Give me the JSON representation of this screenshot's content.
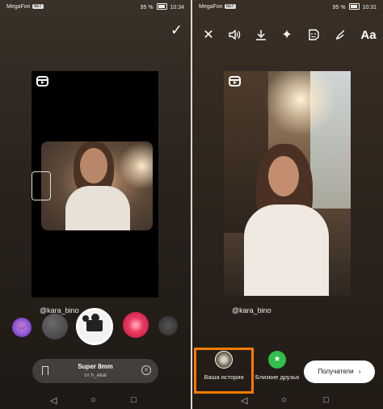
{
  "status_bar": {
    "carrier": "MegaFon",
    "carrier_tag": "NET",
    "battery": "95 %",
    "time_left": "10:34",
    "time_right": "10:31"
  },
  "left": {
    "username": "@kara_bino",
    "effect_name": "Super 8mm",
    "effect_author": "от h_ekal",
    "done_icon": "check-icon"
  },
  "right": {
    "username": "@kara_bino",
    "toolbar": [
      "close-icon",
      "sound-icon",
      "download-icon",
      "effects-icon",
      "sticker-icon",
      "draw-icon",
      "text-tool"
    ],
    "text_tool_label": "Aa",
    "your_story_label": "Ваша история",
    "close_friends_label": "Близкие друзья",
    "send_label": "Получатели",
    "highlight_color": "#ff7a00"
  },
  "navbar": [
    "back-icon",
    "home-icon",
    "recents-icon"
  ]
}
